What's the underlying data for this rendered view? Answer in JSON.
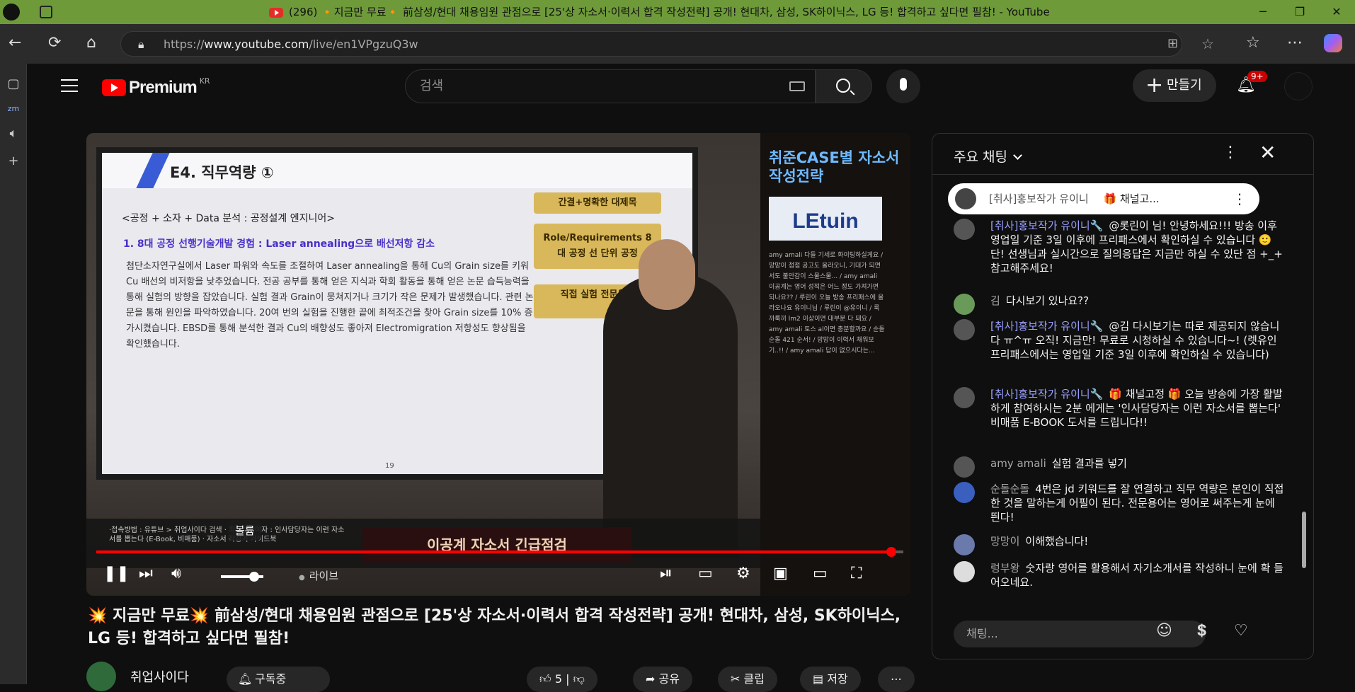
{
  "browser": {
    "tab_title": "(296) 🔸지금만 무료🔸 前삼성/현대 채용임원 관점으로 [25'상 자소서·이력서 합격 작성전략] 공개! 현대차, 삼성, SK하이닉스, LG 등! 합격하고 싶다면 필참! - YouTube",
    "url_prefix": "https://",
    "url_host": "www.youtube.com",
    "url_path": "/live/en1VPgzuQ3w"
  },
  "header": {
    "logo_text": "Premium",
    "logo_region": "KR",
    "search_placeholder": "검색",
    "create_label": "만들기",
    "notif_count": "9+"
  },
  "video": {
    "slide_title": "E4. 직무역량 ①",
    "slide_subtitle": "<공정 + 소자 + Data 분석 : 공정설계 엔지니어>",
    "slide_heading": "1. 8대 공정 선행기술개발 경험 : Laser annealing으로 배선저항 감소",
    "slide_body": "첨단소자연구실에서 Laser 파워와 속도를 조절하여 Laser annealing을 통해 Cu의 Grain size를 키워 Cu 배선의 비저항을 낮추었습니다. 전공 공부를 통해 얻은 지식과 학회 활동을 통해 얻은 논문 습득능력을 통해 실험의 방향을 잡았습니다. 실험 결과 Grain이 뭉쳐지거나 크기가 작은 문제가 발생했습니다. 관련 논문을 통해 원인을 파악하였습니다. 20여 번의 실험을 진행한 끝에 최적조건을 찾아 Grain size를 10% 증가시켰습니다. EBSD를 통해 분석한 결과 Cu의 배향성도 좋아져 Electromigration 저항성도 향상됨을 확인했습니다.",
    "slide_box1": "간결+명확한 대제목",
    "slide_box2": "Role/Requirements 8대 공정 선 단위 공정",
    "slide_box3": "직접 실험 전문용어 ",
    "slide_number": "19",
    "right_title": "취준CASE별 자소서 작성전략",
    "right_logo": "LEtuin",
    "right_chat": "amy amali 다들 기세로 화이팅하실게요 / 망망이 점점 공고도 올라오니, 기대가 되면서도 불안감이 스물스물... / amy amali 이공계는 영어 성적은 어느 정도 가져가면 되나요?? / 루린이 오늘 방송 프리패스에 올라오나요 유이니님 / 루린이 @유이니 / 룩까룩끼 lm2 이상이면 대부분 다 돼요 / amy amali 토스 al이면 충분할까요 / 순돌순돌 421 순서! / 망망이 이력서 채워보기..!! / amy amali 답이 없으시다는...",
    "lower_text": "·접속방법 : 유튜브 > 취업사이다 검색 · 최우수참여자 : 인사담당자는 이런 자소서를 뽑는다 (E-Book, 비매품) · 자소서 작성기 가이드북",
    "banner_text": "이공계 자소서 긴급점검",
    "live_label": "라이브",
    "tooltip": "볼륨",
    "progress": 0.985,
    "volume": 0.7
  },
  "info": {
    "title": "💥 지금만 무료💥  前삼성/현대 채용임원 관점으로 [25'상 자소서·이력서 합격 작성전략] 공개! 현대차, 삼성, SK하이닉스, LG 등! 합격하고 싶다면 필참!",
    "channel": "취업사이다",
    "subscribe_label": "구독중",
    "likes": "5",
    "share_label": "공유",
    "clip_label": "클립",
    "save_label": "저장"
  },
  "chat": {
    "title": "주요 채팅",
    "pinned_name": "[취사]홍보작가 유이니",
    "pinned_text": "🎁 채널고...",
    "input_placeholder": "채팅...",
    "messages": [
      {
        "name": "[취사]홍보작가 유이니🔧",
        "text": "@롯린이 님! 안녕하세요!!! 방송 이후 영업일 기준 3일 이후에 프리패스에서 확인하실 수 있습니다 🙂 단! 선생님과 실시간으로 질의응답은 지금만 하실 수 있단 점 +_+ 참고해주세요!"
      },
      {
        "name": "김",
        "text": "다시보기 있나요??"
      },
      {
        "name": "[취사]홍보작가 유이니🔧",
        "text": "@김 다시보기는 따로 제공되지 않습니다 ㅠ^ㅠ 오직! 지금만! 무료로 시청하실 수 있습니다~! (렛유인 프리패스에서는 영업일 기준 3일 이후에 확인하실 수 있습니다)"
      },
      {
        "name": "[취사]홍보작가 유이니🔧",
        "text": "🎁 채널고정 🎁 오늘 방송에 가장 활발하게 참여하시는 2분 에게는 '인사담당자는 이런 자소서를 뽑는다' 비매품 E-BOOK 도서를 드립니다!!"
      },
      {
        "name": "amy amali",
        "text": "실험 결과를 넣기"
      },
      {
        "name": "순돌순돌",
        "text": "4번은 jd 키워드를 잘 연결하고 직무 역량은 본인이 직접 한 것을 말하는게 어필이 된다. 전문용어는 영어로 써주는게 눈에 띈다!"
      },
      {
        "name": "망망이",
        "text": "이해했습니다!"
      },
      {
        "name": "렁부왕",
        "text": "숫자랑 영어를 활용해서 자기소개서를 작성하니 눈에 확 들어오네요."
      }
    ]
  }
}
